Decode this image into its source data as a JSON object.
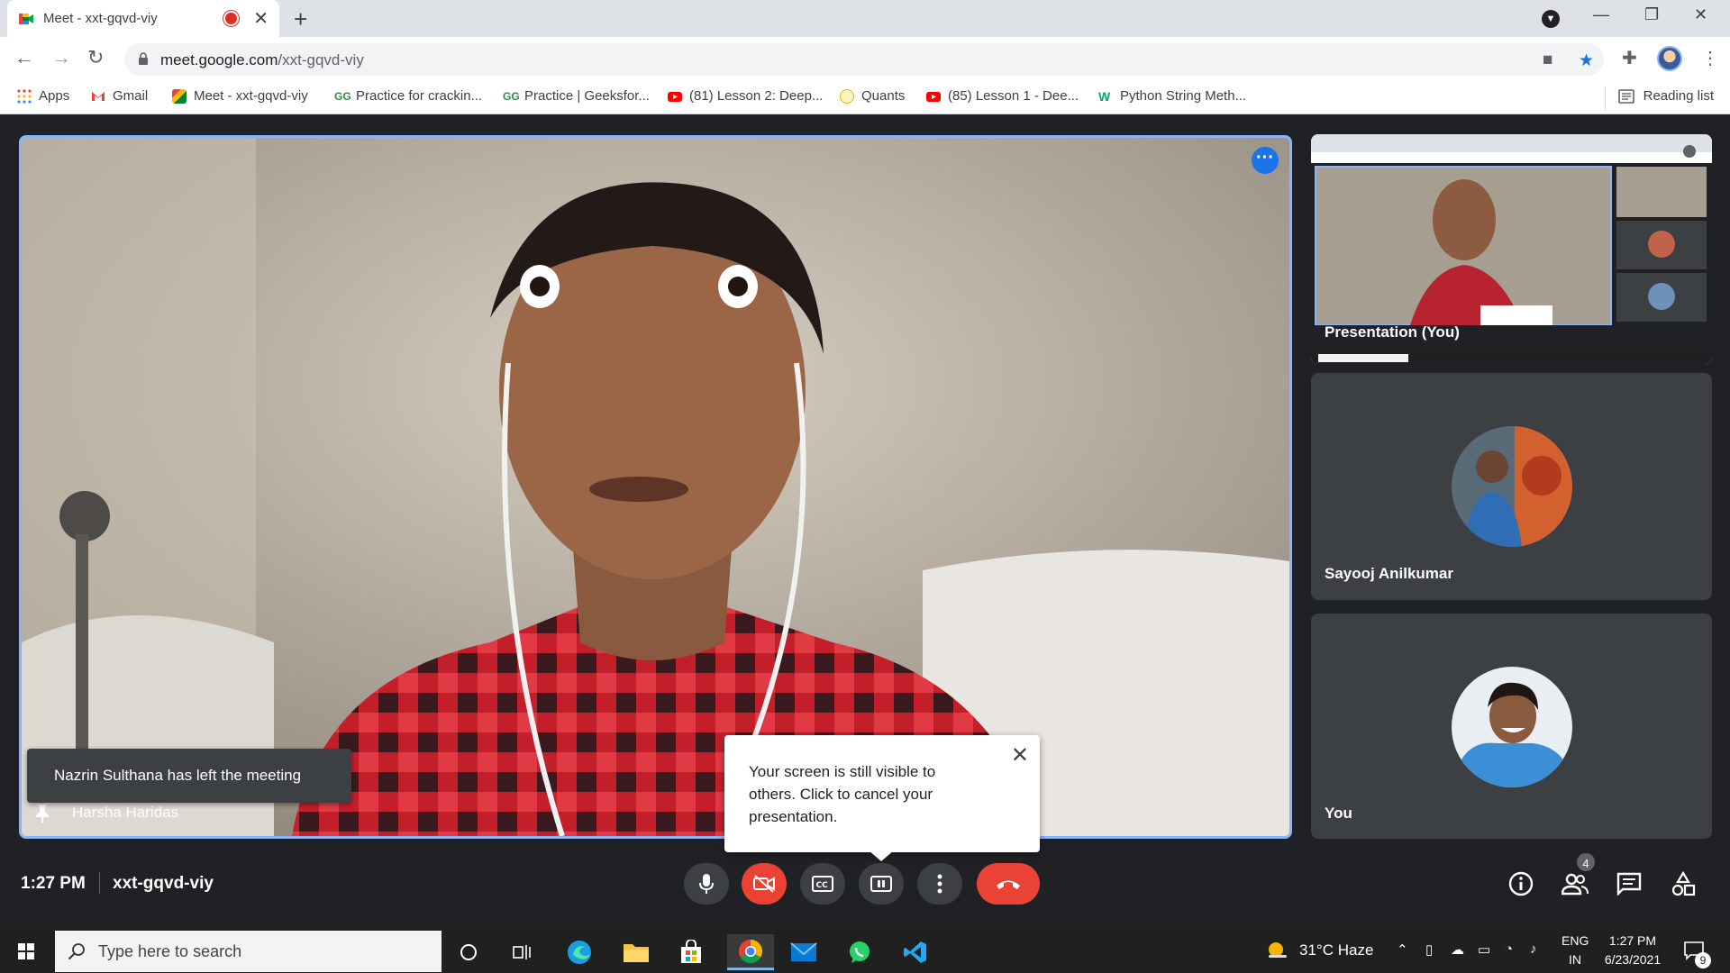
{
  "browser": {
    "tab_title": "Meet - xxt-gqvd-viy",
    "url_host": "meet.google.com",
    "url_path": "/xxt-gqvd-viy",
    "bookmarks": [
      {
        "label": "Apps",
        "icon": "apps-grid-icon",
        "color": "#4285f4"
      },
      {
        "label": "Gmail",
        "icon": "gmail-icon",
        "color": "#ea4335"
      },
      {
        "label": "Meet - xxt-gqvd-viy",
        "icon": "meet-icon",
        "color": "#00897b"
      },
      {
        "label": "Practice for crackin...",
        "icon": "geeksforgeeks-icon",
        "color": "#2f8d46"
      },
      {
        "label": "Practice | Geeksfor...",
        "icon": "geeksforgeeks-icon",
        "color": "#2f8d46"
      },
      {
        "label": "(81) Lesson 2: Deep...",
        "icon": "youtube-icon",
        "color": "#ff0000"
      },
      {
        "label": "Quants",
        "icon": "quants-icon",
        "color": "#f4b400"
      },
      {
        "label": "(85) Lesson 1 - Dee...",
        "icon": "youtube-icon",
        "color": "#ff0000"
      },
      {
        "label": "Python String Meth...",
        "icon": "w3schools-icon",
        "color": "#04aa6d"
      }
    ],
    "reading_list": "Reading list"
  },
  "meet": {
    "main_tile_name": "Harsha Haridas",
    "toast": "Nazrin Sulthana has left the meeting",
    "tooltip": "Your screen is still visible to others. Click to cancel your presentation.",
    "side_tiles": [
      {
        "name": "Presentation (You)"
      },
      {
        "name": "Sayooj Anilkumar"
      },
      {
        "name": "You"
      }
    ],
    "time": "1:27 PM",
    "meeting_code": "xxt-gqvd-viy",
    "participants_count": "4"
  },
  "taskbar": {
    "search_placeholder": "Type here to search",
    "weather": "31°C  Haze",
    "lang_1": "ENG",
    "lang_2": "IN",
    "clock_time": "1:27 PM",
    "clock_date": "6/23/2021",
    "notifications": "9"
  }
}
